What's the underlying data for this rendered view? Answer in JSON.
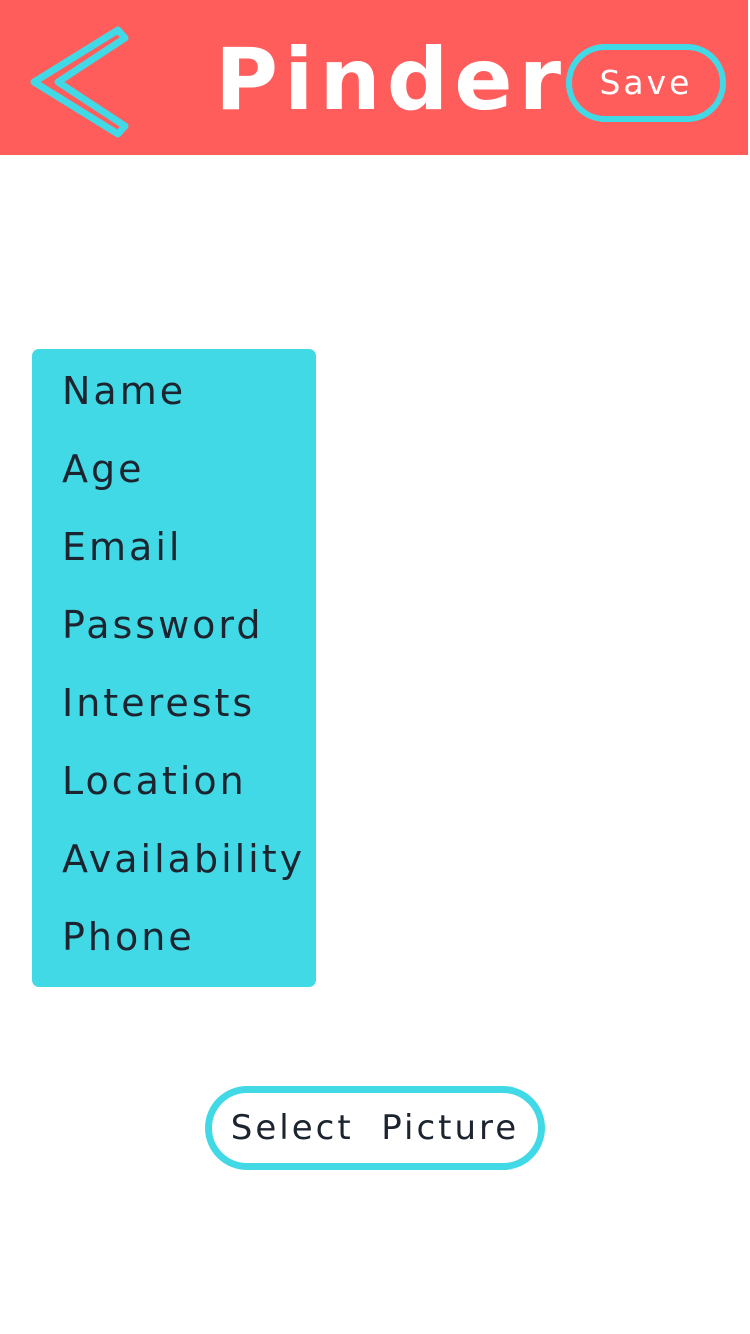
{
  "header": {
    "title": "Pinder",
    "back_icon": "chevron-left-icon",
    "save_label": "Save"
  },
  "fields": [
    {
      "label": "Name"
    },
    {
      "label": "Age"
    },
    {
      "label": "Email"
    },
    {
      "label": "Password"
    },
    {
      "label": "Interests"
    },
    {
      "label": "Location"
    },
    {
      "label": "Availability"
    },
    {
      "label": "Phone"
    }
  ],
  "select_picture_label": "Select  Picture",
  "colors": {
    "header_bg": "#ff5c5c",
    "accent": "#42d9e6",
    "text_light": "#ffffff",
    "text_dark": "#1c2430"
  }
}
